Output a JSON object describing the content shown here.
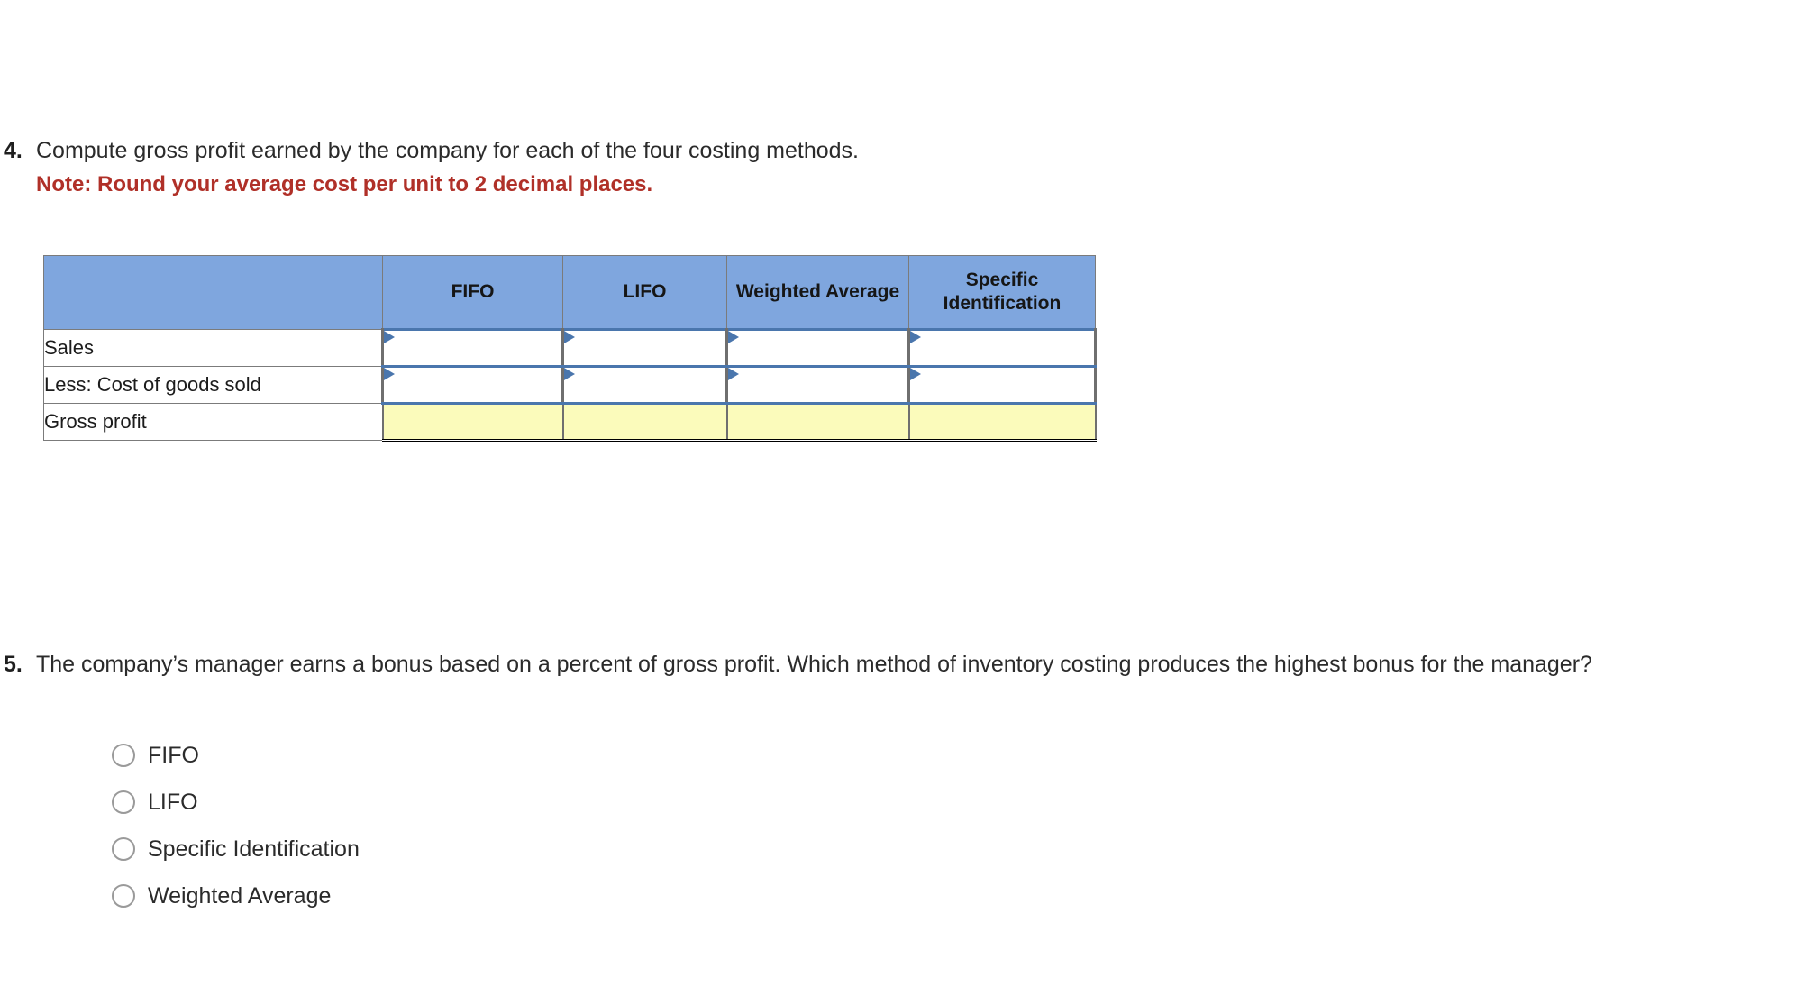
{
  "question4": {
    "number": "4.",
    "text": "Compute gross profit earned by the company for each of the four costing methods.",
    "note": "Note: Round your average cost per unit to 2 decimal places.",
    "note_color": "#b03028"
  },
  "table": {
    "header_bg": "#7fa6de",
    "total_bg": "#fbfbbb",
    "input_border": "#4a76ad",
    "columns": [
      {
        "label": ""
      },
      {
        "label": "FIFO"
      },
      {
        "label": "LIFO"
      },
      {
        "label": "Weighted Average"
      },
      {
        "label": "Specific Identification"
      }
    ],
    "rows": [
      {
        "label": "Sales",
        "type": "input",
        "cells": [
          {
            "value": "",
            "marker": "input-marker-triangle"
          },
          {
            "value": "",
            "marker": "input-marker-triangle"
          },
          {
            "value": "",
            "marker": "input-marker-triangle"
          },
          {
            "value": "",
            "marker": "input-marker-triangle"
          }
        ]
      },
      {
        "label": "Less: Cost of goods sold",
        "type": "input",
        "cells": [
          {
            "value": "",
            "marker": "input-marker-triangle"
          },
          {
            "value": "",
            "marker": "input-marker-triangle"
          },
          {
            "value": "",
            "marker": "input-marker-triangle"
          },
          {
            "value": "",
            "marker": "input-marker-triangle"
          }
        ]
      },
      {
        "label": "Gross profit",
        "type": "total",
        "cells": [
          {
            "value": ""
          },
          {
            "value": ""
          },
          {
            "value": ""
          },
          {
            "value": ""
          }
        ]
      }
    ]
  },
  "question5": {
    "number": "5.",
    "text": "The company’s manager earns a bonus based on a percent of gross profit. Which method of inventory costing produces the highest bonus for the manager?",
    "options": [
      {
        "label": "FIFO",
        "selected": false
      },
      {
        "label": "LIFO",
        "selected": false
      },
      {
        "label": "Specific Identification",
        "selected": false
      },
      {
        "label": "Weighted Average",
        "selected": false
      }
    ]
  }
}
